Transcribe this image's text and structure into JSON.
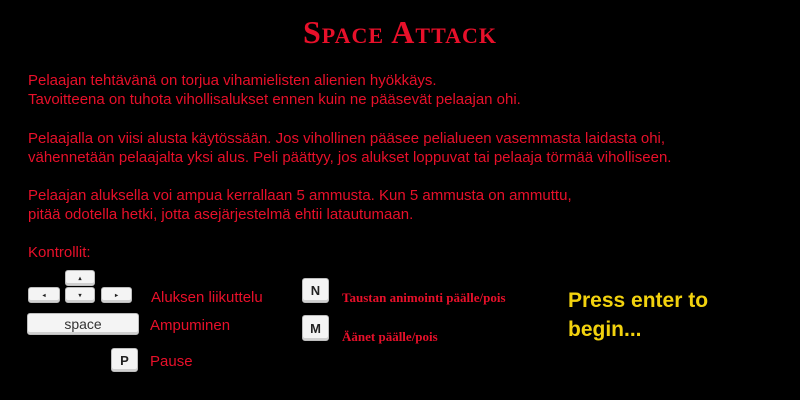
{
  "title": "Space Attack",
  "intro": {
    "line1": "Pelaajan tehtävänä on torjua vihamielisten alienien hyökkäys.",
    "line2": "Tavoitteena on tuhota vihollisalukset ennen kuin ne pääsevät pelaajan ohi."
  },
  "lives": {
    "line1": "Pelaajalla on viisi alusta käytössään. Jos vihollinen pääsee pelialueen vasemmasta laidasta ohi,",
    "line2": "vähennetään pelaajalta yksi alus. Peli päättyy, jos alukset loppuvat tai pelaaja törmää viholliseen."
  },
  "ammo": {
    "line1": "Pelaajan aluksella voi ampua kerrallaan 5 ammusta. Kun 5 ammusta on ammuttu,",
    "line2": "pitää odotella hetki, jotta asejärjestelmä ehtii latautumaan."
  },
  "controls": {
    "heading": "Kontrollit:",
    "arrow_up": "▴",
    "arrow_left": "◂",
    "arrow_down": "▾",
    "arrow_right": "▸",
    "move_label": "Aluksen liikuttelu",
    "space_key": "space",
    "shoot_label": "Ampuminen",
    "pause_key": "P",
    "pause_label": "Pause",
    "n_key": "N",
    "n_label": "Taustan animointi päälle/pois",
    "m_key": "M",
    "m_label": "Äänet päälle/pois"
  },
  "prompt": {
    "line1": "Press enter to",
    "line2": "begin..."
  },
  "colors": {
    "background": "#000000",
    "text": "#e8102a",
    "prompt": "#f2d20e",
    "key": "#f4f4f4"
  }
}
